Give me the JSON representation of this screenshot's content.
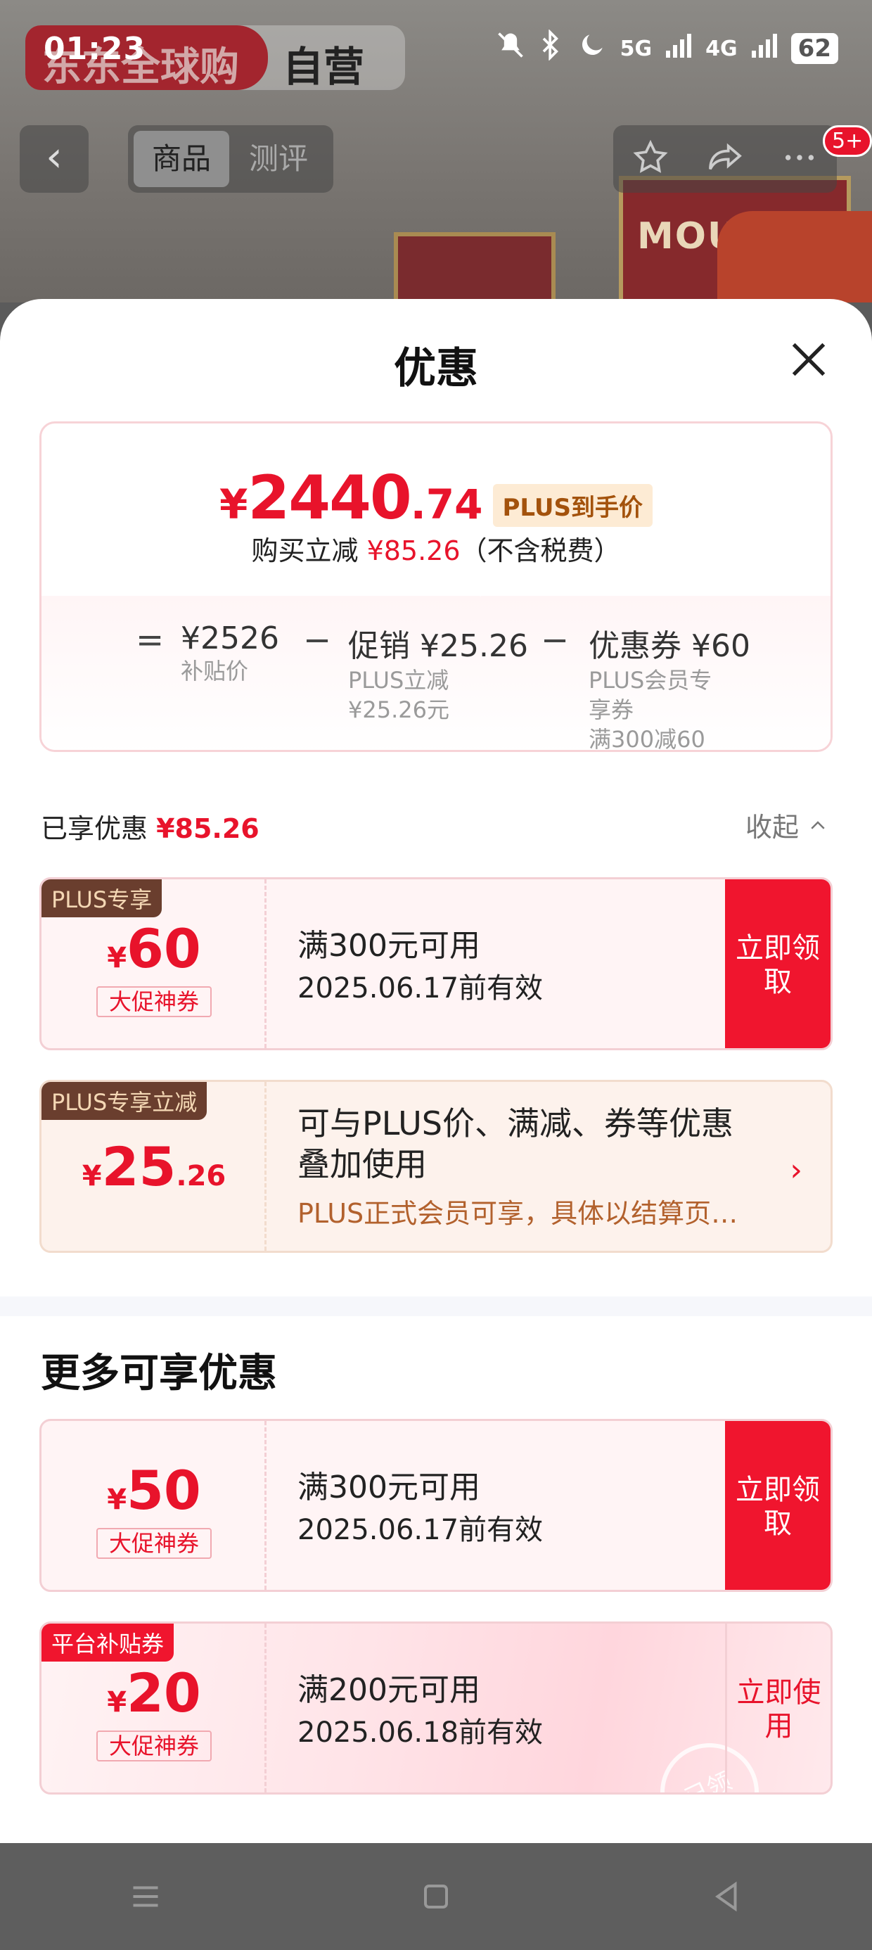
{
  "status_bar": {
    "time": "01:23",
    "net1": "5G",
    "net2": "4G",
    "battery": "62"
  },
  "header": {
    "brand": "东东全球购",
    "self_operated": "自营",
    "tabs": [
      "商品",
      "测评"
    ],
    "badge": "5+",
    "product_text": "MOUT"
  },
  "sheet": {
    "title": "优惠",
    "summary": {
      "currency": "¥",
      "price_int": "2440",
      "price_dec": ".74",
      "plus_tag": "PLUS到手价",
      "reduce_prefix": "购买立减",
      "reduce_amount": "¥85.26",
      "reduce_suffix": "（不含税费）",
      "eq": "=",
      "minus": "−",
      "items": [
        {
          "main": "¥2526",
          "sub1": "补贴价",
          "sub2": "",
          "sub3": ""
        },
        {
          "main": "促销 ¥25.26",
          "sub1": "PLUS立减",
          "sub2": "¥25.26元",
          "sub3": ""
        },
        {
          "main": "优惠券 ¥60",
          "sub1": "PLUS会员专",
          "sub2": "享券",
          "sub3": "满300减60"
        }
      ]
    },
    "enjoyed": {
      "label": "已享优惠",
      "amount": "¥85.26",
      "collapse": "收起"
    },
    "coupons": [
      {
        "tag": "PLUS专享",
        "currency": "¥",
        "amount": "60",
        "decimal": "",
        "label": "大促神券",
        "desc": "满300元可用",
        "date": "2025.06.17前有效",
        "button": "立即领取"
      },
      {
        "tag": "PLUS专享立减",
        "currency": "¥",
        "amount": "25",
        "decimal": ".26",
        "desc": "可与PLUS价、满减、券等优惠叠加使用",
        "note": "PLUS正式会员可享，具体以结算页为准"
      }
    ],
    "more_title": "更多可享优惠",
    "more_coupons": [
      {
        "currency": "¥",
        "amount": "50",
        "label": "大促神券",
        "desc": "满300元可用",
        "date": "2025.06.17前有效",
        "button": "立即领取"
      },
      {
        "tag": "平台补贴券",
        "currency": "¥",
        "amount": "20",
        "label": "大促神券",
        "desc": "满200元可用",
        "date": "2025.06.18前有效",
        "button": "立即使用",
        "stamp": "已领"
      }
    ]
  }
}
